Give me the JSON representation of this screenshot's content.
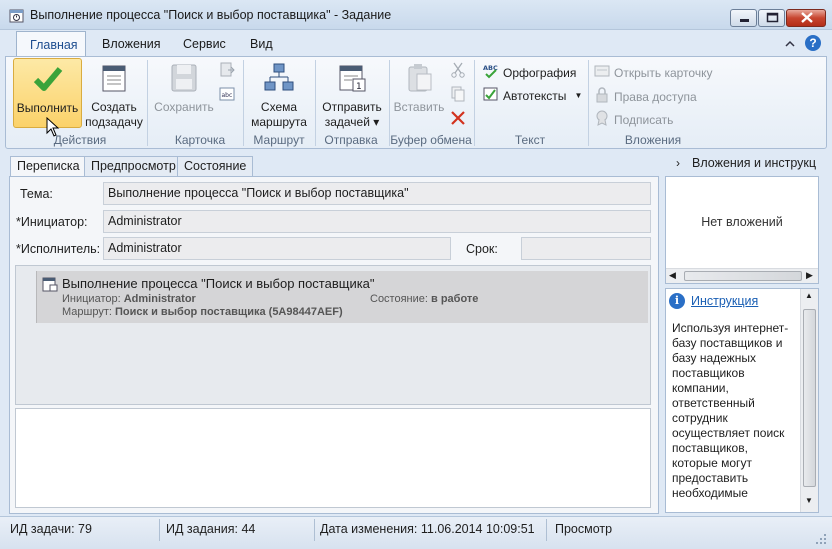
{
  "window": {
    "title": "Выполнение процесса \"Поиск и выбор поставщика\" - Задание"
  },
  "ribbon": {
    "tabs": [
      "Главная",
      "Вложения",
      "Сервис",
      "Вид"
    ],
    "groups": {
      "actions": {
        "label": "Действия",
        "execute": "Выполнить",
        "subtask": [
          "Создать",
          "подзадачу"
        ]
      },
      "card": {
        "label": "Карточка",
        "save": "Сохранить"
      },
      "route": {
        "label": "Маршрут",
        "scheme": [
          "Схема",
          "маршрута"
        ]
      },
      "send": {
        "label": "Отправка",
        "send": [
          "Отправить",
          "задачей ▾"
        ]
      },
      "clipboard": {
        "label": "Буфер обмена",
        "paste": "Вставить"
      },
      "text": {
        "label": "Текст",
        "spelling": "Орфография",
        "autotext": "Автотексты"
      },
      "attachments": {
        "label": "Вложения",
        "open_card": "Открыть карточку",
        "access": "Права доступа",
        "sign": "Подписать"
      }
    }
  },
  "subtabs": [
    "Переписка",
    "Предпросмотр",
    "Состояние"
  ],
  "form": {
    "subject_label": "Тема:",
    "subject_value": "Выполнение процесса \"Поиск и выбор поставщика\"",
    "initiator_label": "*Инициатор:",
    "initiator_value": "Administrator",
    "performer_label": "*Исполнитель:",
    "performer_value": "Administrator",
    "deadline_label": "Срок:",
    "deadline_value": ""
  },
  "workflow_card": {
    "title": "Выполнение процесса \"Поиск и выбор поставщика\"",
    "initiator_label": "Инициатор:",
    "initiator_value": "Administrator",
    "state_label": "Состояние:",
    "state_value": "в работе",
    "route_label": "Маршрут:",
    "route_value": "Поиск и выбор поставщика (5A98447AEF)"
  },
  "right_pane": {
    "header": "Вложения и инструкц",
    "no_attachments": "Нет вложений",
    "instruction_link": "Инструкция",
    "instruction_text": "Используя интернет-базу поставщиков и базу надежных поставщиков компании, ответственный сотрудник осуществляет поиск поставщиков, которые могут предоставить необходимые"
  },
  "status": {
    "task_id": "ИД задачи: 79",
    "job_id": "ИД задания: 44",
    "modified": "Дата изменения: 11.06.2014 10:09:51",
    "mode": "Просмотр"
  },
  "colors": {
    "accent": "#1d4d8f",
    "link": "#1a5fb4",
    "check_green": "#3aa33a",
    "delete_red": "#d2321e"
  }
}
